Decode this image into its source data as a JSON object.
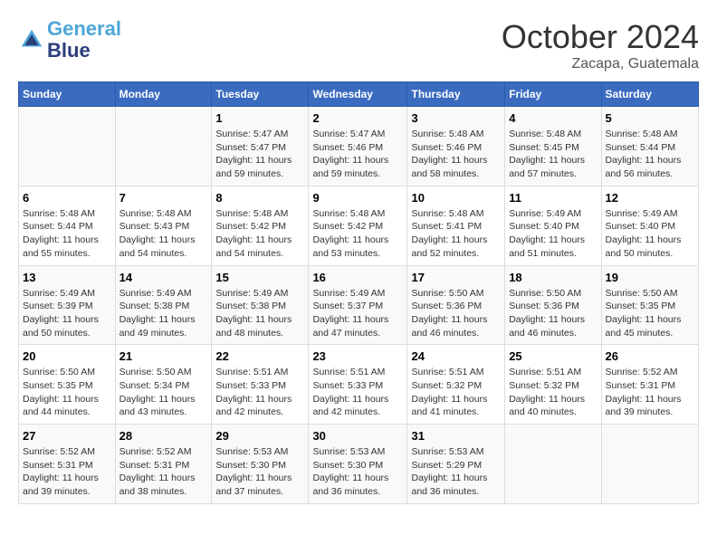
{
  "header": {
    "logo_line1": "General",
    "logo_line2": "Blue",
    "month": "October 2024",
    "location": "Zacapa, Guatemala"
  },
  "weekdays": [
    "Sunday",
    "Monday",
    "Tuesday",
    "Wednesday",
    "Thursday",
    "Friday",
    "Saturday"
  ],
  "weeks": [
    [
      {
        "day": "",
        "info": ""
      },
      {
        "day": "",
        "info": ""
      },
      {
        "day": "1",
        "info": "Sunrise: 5:47 AM\nSunset: 5:47 PM\nDaylight: 11 hours and 59 minutes."
      },
      {
        "day": "2",
        "info": "Sunrise: 5:47 AM\nSunset: 5:46 PM\nDaylight: 11 hours and 59 minutes."
      },
      {
        "day": "3",
        "info": "Sunrise: 5:48 AM\nSunset: 5:46 PM\nDaylight: 11 hours and 58 minutes."
      },
      {
        "day": "4",
        "info": "Sunrise: 5:48 AM\nSunset: 5:45 PM\nDaylight: 11 hours and 57 minutes."
      },
      {
        "day": "5",
        "info": "Sunrise: 5:48 AM\nSunset: 5:44 PM\nDaylight: 11 hours and 56 minutes."
      }
    ],
    [
      {
        "day": "6",
        "info": "Sunrise: 5:48 AM\nSunset: 5:44 PM\nDaylight: 11 hours and 55 minutes."
      },
      {
        "day": "7",
        "info": "Sunrise: 5:48 AM\nSunset: 5:43 PM\nDaylight: 11 hours and 54 minutes."
      },
      {
        "day": "8",
        "info": "Sunrise: 5:48 AM\nSunset: 5:42 PM\nDaylight: 11 hours and 54 minutes."
      },
      {
        "day": "9",
        "info": "Sunrise: 5:48 AM\nSunset: 5:42 PM\nDaylight: 11 hours and 53 minutes."
      },
      {
        "day": "10",
        "info": "Sunrise: 5:48 AM\nSunset: 5:41 PM\nDaylight: 11 hours and 52 minutes."
      },
      {
        "day": "11",
        "info": "Sunrise: 5:49 AM\nSunset: 5:40 PM\nDaylight: 11 hours and 51 minutes."
      },
      {
        "day": "12",
        "info": "Sunrise: 5:49 AM\nSunset: 5:40 PM\nDaylight: 11 hours and 50 minutes."
      }
    ],
    [
      {
        "day": "13",
        "info": "Sunrise: 5:49 AM\nSunset: 5:39 PM\nDaylight: 11 hours and 50 minutes."
      },
      {
        "day": "14",
        "info": "Sunrise: 5:49 AM\nSunset: 5:38 PM\nDaylight: 11 hours and 49 minutes."
      },
      {
        "day": "15",
        "info": "Sunrise: 5:49 AM\nSunset: 5:38 PM\nDaylight: 11 hours and 48 minutes."
      },
      {
        "day": "16",
        "info": "Sunrise: 5:49 AM\nSunset: 5:37 PM\nDaylight: 11 hours and 47 minutes."
      },
      {
        "day": "17",
        "info": "Sunrise: 5:50 AM\nSunset: 5:36 PM\nDaylight: 11 hours and 46 minutes."
      },
      {
        "day": "18",
        "info": "Sunrise: 5:50 AM\nSunset: 5:36 PM\nDaylight: 11 hours and 46 minutes."
      },
      {
        "day": "19",
        "info": "Sunrise: 5:50 AM\nSunset: 5:35 PM\nDaylight: 11 hours and 45 minutes."
      }
    ],
    [
      {
        "day": "20",
        "info": "Sunrise: 5:50 AM\nSunset: 5:35 PM\nDaylight: 11 hours and 44 minutes."
      },
      {
        "day": "21",
        "info": "Sunrise: 5:50 AM\nSunset: 5:34 PM\nDaylight: 11 hours and 43 minutes."
      },
      {
        "day": "22",
        "info": "Sunrise: 5:51 AM\nSunset: 5:33 PM\nDaylight: 11 hours and 42 minutes."
      },
      {
        "day": "23",
        "info": "Sunrise: 5:51 AM\nSunset: 5:33 PM\nDaylight: 11 hours and 42 minutes."
      },
      {
        "day": "24",
        "info": "Sunrise: 5:51 AM\nSunset: 5:32 PM\nDaylight: 11 hours and 41 minutes."
      },
      {
        "day": "25",
        "info": "Sunrise: 5:51 AM\nSunset: 5:32 PM\nDaylight: 11 hours and 40 minutes."
      },
      {
        "day": "26",
        "info": "Sunrise: 5:52 AM\nSunset: 5:31 PM\nDaylight: 11 hours and 39 minutes."
      }
    ],
    [
      {
        "day": "27",
        "info": "Sunrise: 5:52 AM\nSunset: 5:31 PM\nDaylight: 11 hours and 39 minutes."
      },
      {
        "day": "28",
        "info": "Sunrise: 5:52 AM\nSunset: 5:31 PM\nDaylight: 11 hours and 38 minutes."
      },
      {
        "day": "29",
        "info": "Sunrise: 5:53 AM\nSunset: 5:30 PM\nDaylight: 11 hours and 37 minutes."
      },
      {
        "day": "30",
        "info": "Sunrise: 5:53 AM\nSunset: 5:30 PM\nDaylight: 11 hours and 36 minutes."
      },
      {
        "day": "31",
        "info": "Sunrise: 5:53 AM\nSunset: 5:29 PM\nDaylight: 11 hours and 36 minutes."
      },
      {
        "day": "",
        "info": ""
      },
      {
        "day": "",
        "info": ""
      }
    ]
  ]
}
